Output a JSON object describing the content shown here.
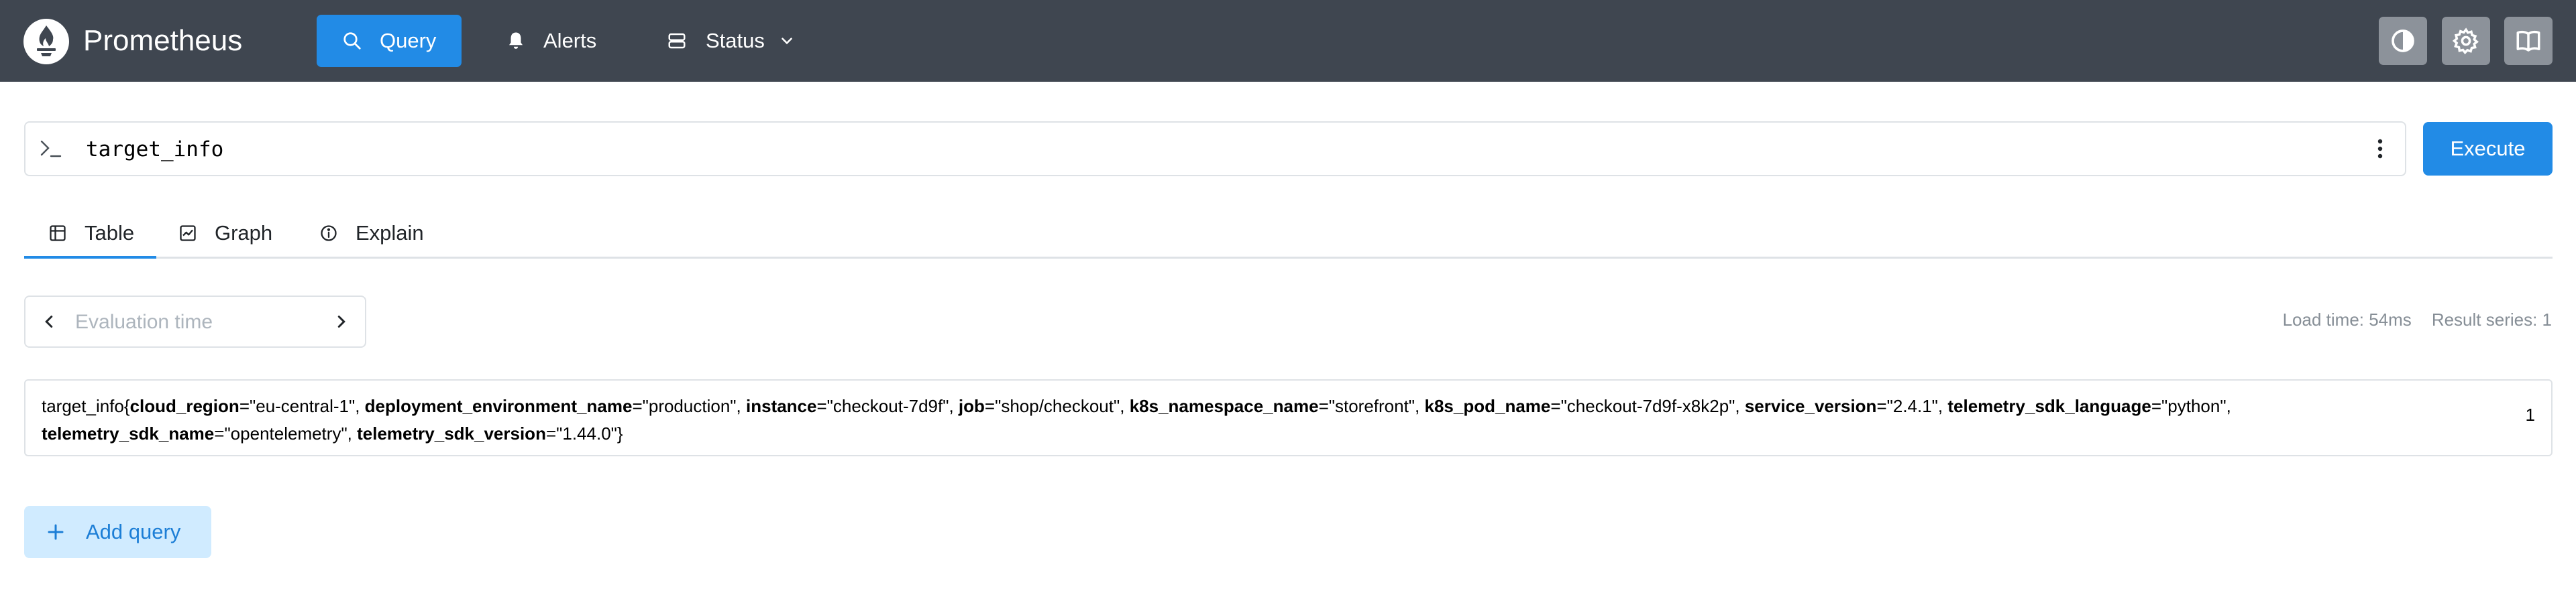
{
  "header": {
    "brand": "Prometheus",
    "nav": {
      "query_label": "Query",
      "alerts_label": "Alerts",
      "status_label": "Status"
    },
    "icons": [
      "prometheus-logo",
      "search-icon",
      "bell-icon",
      "server-icon",
      "chevron-down-icon",
      "contrast-icon",
      "gear-icon",
      "book-icon"
    ],
    "colors": {
      "header_bg": "#3f4650",
      "accent": "#228be6"
    }
  },
  "query": {
    "expression": "target_info",
    "execute_label": "Execute"
  },
  "tabs": [
    {
      "label": "Table",
      "active": true
    },
    {
      "label": "Graph",
      "active": false
    },
    {
      "label": "Explain",
      "active": false
    }
  ],
  "eval_time": {
    "placeholder": "Evaluation time"
  },
  "stats": {
    "load_time": "Load time: 54ms",
    "result_series": "Result series: 1"
  },
  "result": {
    "metric": "target_info",
    "labels": [
      {
        "name": "cloud_region",
        "value": "\"eu-central-1\""
      },
      {
        "name": "deployment_environment_name",
        "value": "\"production\""
      },
      {
        "name": "instance",
        "value": "\"checkout-7d9f\""
      },
      {
        "name": "job",
        "value": "\"shop/checkout\""
      },
      {
        "name": "k8s_namespace_name",
        "value": "\"storefront\""
      },
      {
        "name": "k8s_pod_name",
        "value": "\"checkout-7d9f-x8k2p\""
      },
      {
        "name": "service_version",
        "value": "\"2.4.1\""
      },
      {
        "name": "telemetry_sdk_language",
        "value": "\"python\""
      },
      {
        "name": "telemetry_sdk_name",
        "value": "\"opentelemetry\""
      },
      {
        "name": "telemetry_sdk_version",
        "value": "\"1.44.0\""
      }
    ],
    "value": "1"
  },
  "add_query_label": "Add query"
}
